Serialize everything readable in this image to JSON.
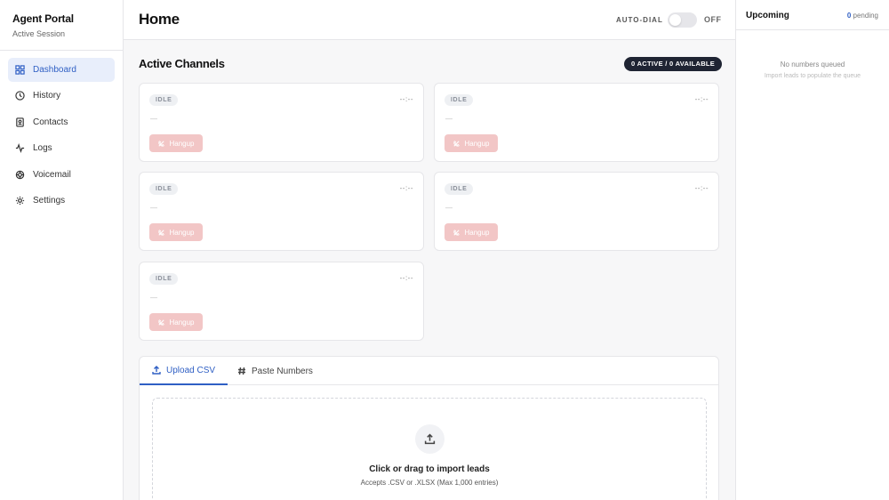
{
  "sidebar": {
    "title": "Agent Portal",
    "subtitle": "Active Session",
    "items": [
      {
        "label": "Dashboard",
        "icon": "grid-icon",
        "active": true
      },
      {
        "label": "History",
        "icon": "clock-icon"
      },
      {
        "label": "Contacts",
        "icon": "contact-book-icon"
      },
      {
        "label": "Logs",
        "icon": "activity-icon"
      },
      {
        "label": "Voicemail",
        "icon": "voicemail-icon"
      },
      {
        "label": "Settings",
        "icon": "gear-icon"
      }
    ]
  },
  "header": {
    "title": "Home",
    "autodial_label": "AUTO-DIAL",
    "autodial_state": "OFF"
  },
  "channels": {
    "title": "Active Channels",
    "badge": "0 ACTIVE / 0 AVAILABLE",
    "cards": [
      {
        "status": "IDLE",
        "timer": "--:--",
        "number": "—",
        "action": "Hangup"
      },
      {
        "status": "IDLE",
        "timer": "--:--",
        "number": "—",
        "action": "Hangup"
      },
      {
        "status": "IDLE",
        "timer": "--:--",
        "number": "—",
        "action": "Hangup"
      },
      {
        "status": "IDLE",
        "timer": "--:--",
        "number": "—",
        "action": "Hangup"
      },
      {
        "status": "IDLE",
        "timer": "--:--",
        "number": "—",
        "action": "Hangup"
      }
    ]
  },
  "import": {
    "tabs": [
      {
        "label": "Upload CSV",
        "icon": "upload-icon",
        "active": true
      },
      {
        "label": "Paste Numbers",
        "icon": "hash-icon"
      }
    ],
    "drop_title": "Click or drag to import leads",
    "drop_sub": "Accepts .CSV or .XLSX (Max 1,000 entries)"
  },
  "upcoming": {
    "title": "Upcoming",
    "pending_count": "0",
    "pending_label": "pending",
    "empty_title": "No numbers queued",
    "empty_sub": "Import leads to populate the queue"
  },
  "colors": {
    "accent": "#2f5fc4",
    "badge_dark": "#1f2433",
    "hangup_disabled": "#f2c6c6"
  }
}
